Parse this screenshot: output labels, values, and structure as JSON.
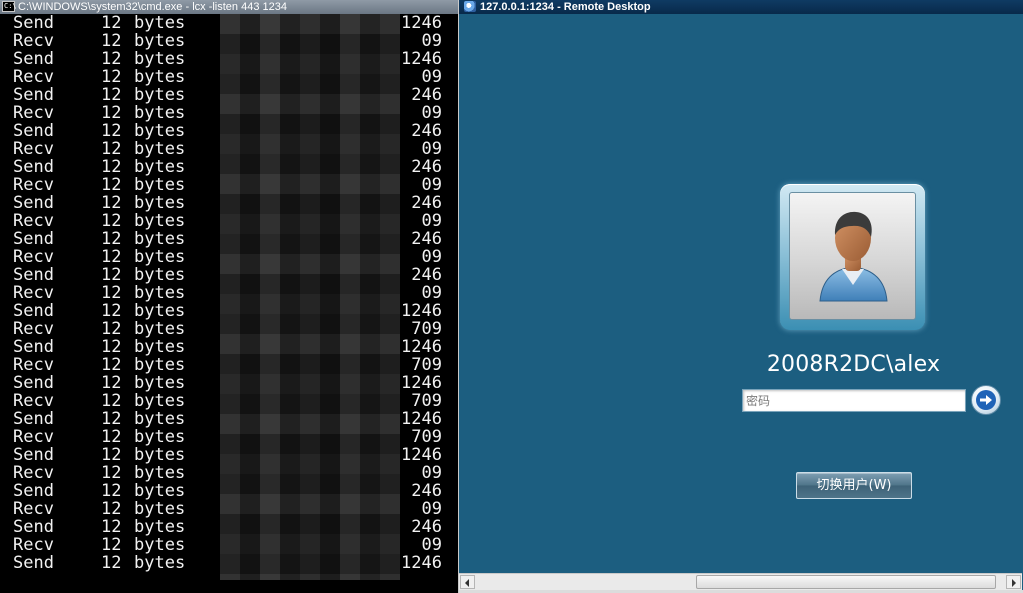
{
  "cmd": {
    "title": "C:\\WINDOWS\\system32\\cmd.exe - lcx -listen 443 1234",
    "icon_label": "C:\\",
    "lines": [
      {
        "dir": "Send",
        "num": "12",
        "unit": "bytes",
        "tail": "1246"
      },
      {
        "dir": "Recv",
        "num": "12",
        "unit": "bytes",
        "tail": "09"
      },
      {
        "dir": "Send",
        "num": "12",
        "unit": "bytes",
        "tail": "1246"
      },
      {
        "dir": "Recv",
        "num": "12",
        "unit": "bytes",
        "tail": "09"
      },
      {
        "dir": "Send",
        "num": "12",
        "unit": "bytes",
        "tail": "246"
      },
      {
        "dir": "Recv",
        "num": "12",
        "unit": "bytes",
        "tail": "09"
      },
      {
        "dir": "Send",
        "num": "12",
        "unit": "bytes",
        "tail": "246"
      },
      {
        "dir": "Recv",
        "num": "12",
        "unit": "bytes",
        "tail": "09"
      },
      {
        "dir": "Send",
        "num": "12",
        "unit": "bytes",
        "tail": "246"
      },
      {
        "dir": "Recv",
        "num": "12",
        "unit": "bytes",
        "tail": "09"
      },
      {
        "dir": "Send",
        "num": "12",
        "unit": "bytes",
        "tail": "246"
      },
      {
        "dir": "Recv",
        "num": "12",
        "unit": "bytes",
        "tail": "09"
      },
      {
        "dir": "Send",
        "num": "12",
        "unit": "bytes",
        "tail": "246"
      },
      {
        "dir": "Recv",
        "num": "12",
        "unit": "bytes",
        "tail": "09"
      },
      {
        "dir": "Send",
        "num": "12",
        "unit": "bytes",
        "tail": "246"
      },
      {
        "dir": "Recv",
        "num": "12",
        "unit": "bytes",
        "tail": "09"
      },
      {
        "dir": "Send",
        "num": "12",
        "unit": "bytes",
        "tail": "1246"
      },
      {
        "dir": "Recv",
        "num": "12",
        "unit": "bytes",
        "tail": "709"
      },
      {
        "dir": "Send",
        "num": "12",
        "unit": "bytes",
        "tail": "1246"
      },
      {
        "dir": "Recv",
        "num": "12",
        "unit": "bytes",
        "tail": "709"
      },
      {
        "dir": "Send",
        "num": "12",
        "unit": "bytes",
        "tail": "1246"
      },
      {
        "dir": "Recv",
        "num": "12",
        "unit": "bytes",
        "tail": "709"
      },
      {
        "dir": "Send",
        "num": "12",
        "unit": "bytes",
        "tail": "1246"
      },
      {
        "dir": "Recv",
        "num": "12",
        "unit": "bytes",
        "tail": "709"
      },
      {
        "dir": "Send",
        "num": "12",
        "unit": "bytes",
        "tail": "1246"
      },
      {
        "dir": "Recv",
        "num": "12",
        "unit": "bytes",
        "tail": "09"
      },
      {
        "dir": "Send",
        "num": "12",
        "unit": "bytes",
        "tail": "246"
      },
      {
        "dir": "Recv",
        "num": "12",
        "unit": "bytes",
        "tail": "09"
      },
      {
        "dir": "Send",
        "num": "12",
        "unit": "bytes",
        "tail": "246"
      },
      {
        "dir": "Recv",
        "num": "12",
        "unit": "bytes",
        "tail": "09"
      },
      {
        "dir": "Send",
        "num": "12",
        "unit": "bytes",
        "tail": "1246"
      }
    ]
  },
  "rdp": {
    "title": "127.0.0.1:1234 - Remote Desktop",
    "title_icon": "remote-desktop-icon",
    "username": "2008R2DC\\alex",
    "password_placeholder": "密码",
    "go_icon": "arrow-right-icon",
    "switch_user_label": "切换用户(W)",
    "avatar_icon": "user-avatar-icon",
    "colors": {
      "desktop_bg": "#1c5e80",
      "titlebar_bg": "#0f3b63",
      "button_bg": "#4e7489"
    }
  }
}
